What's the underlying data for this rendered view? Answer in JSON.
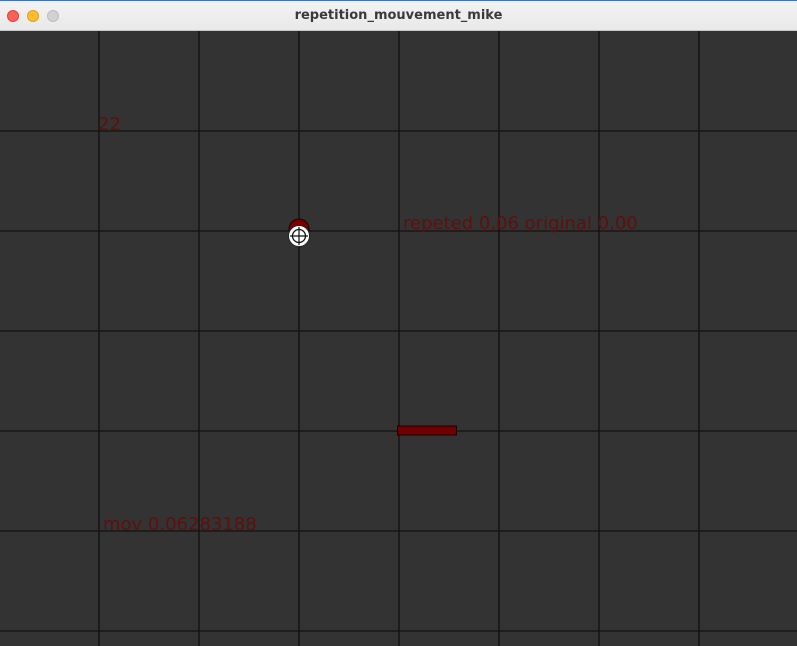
{
  "window": {
    "title": "repetition_mouvement_mike"
  },
  "sketch": {
    "counter_text": "22",
    "status_text": "repeted  0,06 original 0,00",
    "mov_text": "mov 0.06283188"
  },
  "colors": {
    "background": "#333333",
    "grid": "#111111",
    "accent": "#7a0000",
    "text": "#5e0f0f"
  },
  "icons": {
    "cursor": "crosshair-cursor-icon"
  }
}
